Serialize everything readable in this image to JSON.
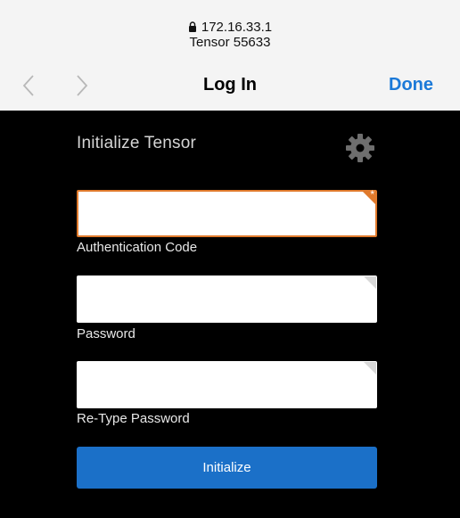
{
  "browser": {
    "url": "172.16.33.1",
    "page_subtitle": "Tensor 55633",
    "nav_title": "Log In",
    "done_label": "Done"
  },
  "form": {
    "title": "Initialize Tensor",
    "fields": [
      {
        "label": "Authentication Code",
        "value": "",
        "required": true,
        "required_marker": "*"
      },
      {
        "label": "Password",
        "value": ""
      },
      {
        "label": "Re-Type Password",
        "value": ""
      }
    ],
    "submit_label": "Initialize"
  },
  "colors": {
    "accent": "#1b79d8",
    "button": "#1b70c8",
    "required_border": "#e07a2c",
    "background": "#000000"
  },
  "icons": [
    "lock-icon",
    "chevron-left-icon",
    "chevron-right-icon",
    "gear-icon"
  ]
}
